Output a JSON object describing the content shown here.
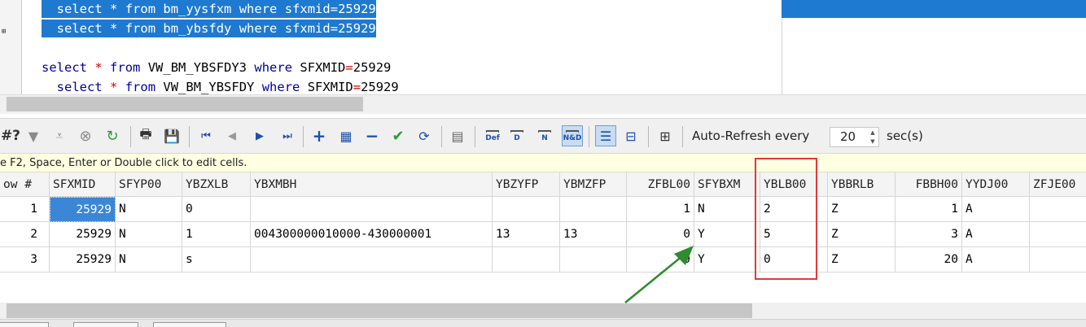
{
  "editor": {
    "lines": [
      {
        "indent": "  ",
        "kw1": "select",
        "star": "*",
        "kw2": "from",
        "table": "bm_yysfxm",
        "kw3": "where",
        "col": "sfxmid",
        "eq": "=",
        "val": "25929"
      },
      {
        "indent": "  ",
        "kw1": "select",
        "star": "*",
        "kw2": "from",
        "table": "bm_ybsfdy",
        "kw3": "where",
        "col": "sfxmid",
        "eq": "=",
        "val": "25929"
      },
      {
        "indent": "",
        "kw1": "select",
        "star": "*",
        "kw2": "from",
        "table": "VW_BM_YBSFDY3",
        "kw3": "where",
        "col": "SFXMID",
        "eq": "=",
        "val": "25929"
      },
      {
        "indent": "  ",
        "kw1": "select",
        "star": "*",
        "kw2": "from",
        "table": "VW_BM_YBSFDY",
        "kw3": "where",
        "col": "SFXMID",
        "eq": "=",
        "val": "25929"
      }
    ],
    "fold_marker": "⊞"
  },
  "toolbar": {
    "query_icon_text": "#?",
    "auto_refresh_label": "Auto-Refresh every",
    "refresh_interval": "20",
    "refresh_unit": "sec(s)",
    "def_label": "Def",
    "d_label": "D",
    "n_label": "N",
    "nd_label": "N&D"
  },
  "hint": "e F2, Space, Enter or Double click to edit cells.",
  "grid": {
    "row_header": "ow  #",
    "columns": [
      "SFXMID",
      "SFYP00",
      "YBZXLB",
      "YBXMBH",
      "YBZYFP",
      "YBMZFP",
      "ZFBL00",
      "SFYBXM",
      "YBLB00",
      "YBBRLB",
      "FBBH00",
      "YYDJ00",
      "ZFJE00"
    ],
    "rows": [
      {
        "num": "1",
        "cells": [
          "25929",
          "N",
          "0",
          "",
          "",
          "",
          "1",
          "N",
          "2",
          "Z",
          "1",
          "A",
          ""
        ]
      },
      {
        "num": "2",
        "cells": [
          "25929",
          "N",
          "1",
          "004300000010000-430000001",
          "13",
          "13",
          "0",
          "Y",
          "5",
          "Z",
          "3",
          "A",
          ""
        ]
      },
      {
        "num": "3",
        "cells": [
          "25929",
          "N",
          "s",
          "",
          "",
          "",
          "0",
          "Y",
          "0",
          "Z",
          "20",
          "A",
          ""
        ]
      }
    ]
  },
  "colors": {
    "selection": "#1e79d0",
    "keyword": "#0000a0",
    "operator": "#d40000",
    "highlight_box": "#e03a3a",
    "arrow": "#2e8b2e"
  }
}
